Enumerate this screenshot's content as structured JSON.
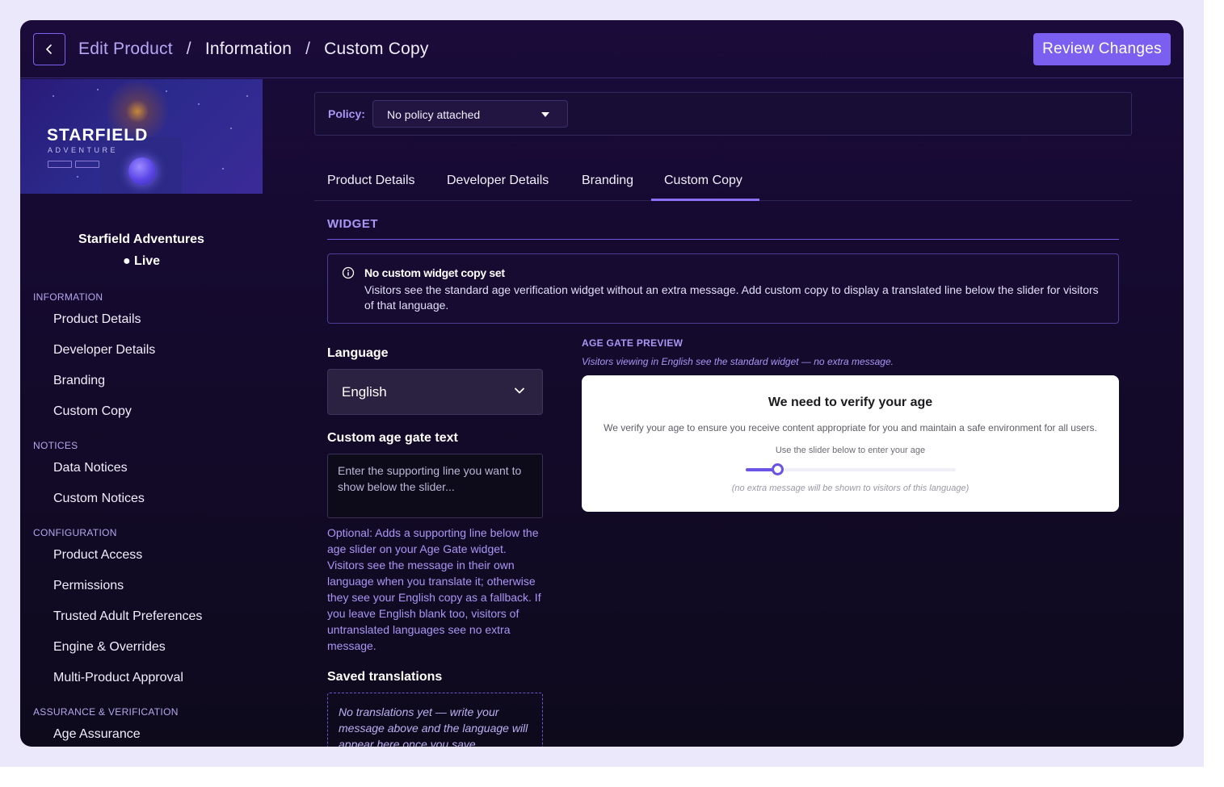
{
  "header": {
    "breadcrumb": [
      "Edit Product",
      "Information",
      "Custom Copy"
    ],
    "separator": "/",
    "review_button": "Review Changes"
  },
  "sidebar": {
    "thumbnail": {
      "title": "STARFIELD",
      "subtitle": "ADVENTURE"
    },
    "product_name": "Starfield Adventures",
    "status": "● Live",
    "sections": [
      {
        "label": "INFORMATION",
        "items": [
          "Product Details",
          "Developer Details",
          "Branding",
          "Custom Copy"
        ]
      },
      {
        "label": "NOTICES",
        "items": [
          "Data Notices",
          "Custom Notices"
        ]
      },
      {
        "label": "CONFIGURATION",
        "items": [
          "Product Access",
          "Permissions",
          "Trusted Adult Preferences",
          "Engine & Overrides",
          "Multi-Product Approval"
        ]
      },
      {
        "label": "ASSURANCE & VERIFICATION",
        "items": [
          "Age Assurance"
        ]
      }
    ]
  },
  "policy": {
    "label": "Policy:",
    "value": "No policy attached"
  },
  "tabs": [
    "Product Details",
    "Developer Details",
    "Branding",
    "Custom Copy"
  ],
  "active_tab": "Custom Copy",
  "widget": {
    "title": "WIDGET",
    "info_title": "No custom widget copy set",
    "info_body": "Visitors see the standard age verification widget without an extra message. Add custom copy to display a translated line below the slider for visitors of that language."
  },
  "form": {
    "language_label": "Language",
    "language_value": "English",
    "custom_text_label": "Custom age gate text",
    "custom_text_placeholder": "Enter the supporting line you want to show below the slider...",
    "hint": "Optional: Adds a supporting line below the age slider on your Age Gate widget. Visitors see the message in their own language when you translate it; otherwise they see your English copy as a fallback. If you leave English blank too, visitors of untranslated languages see no extra message.",
    "saved_label": "Saved translations",
    "saved_empty": "No translations yet — write your message above and the language will appear here once you save."
  },
  "preview": {
    "label": "AGE GATE PREVIEW",
    "note": "Visitors viewing in English see the standard widget — no extra message.",
    "title": "We need to verify your age",
    "body": "We verify your age to ensure you receive content appropriate for you and maintain a safe environment for all users.",
    "slider_label": "Use the slider below to enter your age",
    "slider_level": 0.15,
    "footer_note": "(no extra message will be shown to visitors of this language)"
  },
  "colors": {
    "accent": "#7a5ff0",
    "accent_text": "#a996f5",
    "background": "#140a2c"
  },
  "icons": [
    "chevron-left-icon",
    "caret-down-icon",
    "info-icon",
    "chevron-down-icon"
  ]
}
